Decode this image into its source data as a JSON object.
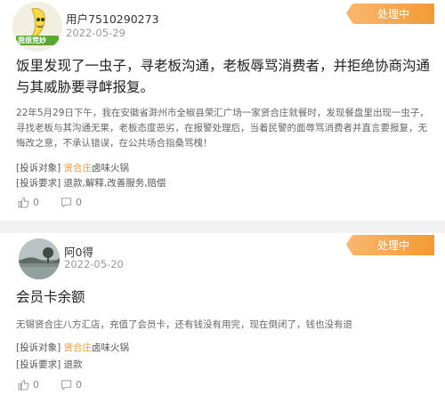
{
  "posts": [
    {
      "username": "用户7510290273",
      "date": "2022-05-29",
      "status": "处理中",
      "title": "饭里发现了一虫子，寻老板沟通，老板辱骂消费者，并拒绝协商沟通与其威胁要寻衅报复。",
      "body": "22年5月29日下午，我在安徽省滁州市全椒县荣汇广场一家贤合庄就餐时，发现餐盘里出现一虫子，寻找老板与其沟通无果，老板态度恶劣，在报警处理后，当着民警的面辱骂消费者并直言要报复，无悔改之意，不承认错误，在公共场合指桑骂槐！",
      "complaint_target_label": "[投诉对象]",
      "complaint_target_brand": "贤合庄",
      "complaint_target_rest": "卤味火锅",
      "complaint_request_label": "[投诉要求]",
      "complaint_request": "退款,解释,改善服务,赔偿",
      "likes": "0",
      "comments": "0"
    },
    {
      "username": "阿0得",
      "date": "2022-05-20",
      "status": "处理中",
      "title": "会员卡余额",
      "body": "无锡贤合庄八方汇店，充值了会员卡，还有钱没有用完，现在倒闭了，钱也没有退",
      "complaint_target_label": "[投诉对象]",
      "complaint_target_brand": "贤合庄",
      "complaint_target_rest": "卤味火锅",
      "complaint_request_label": "[投诉要求]",
      "complaint_request": "退款",
      "likes": "0",
      "comments": "0"
    }
  ],
  "avatar1_text": "我很荒妙",
  "colors": {
    "accent": "#f39a36",
    "badge_start": "#f9b56b"
  }
}
